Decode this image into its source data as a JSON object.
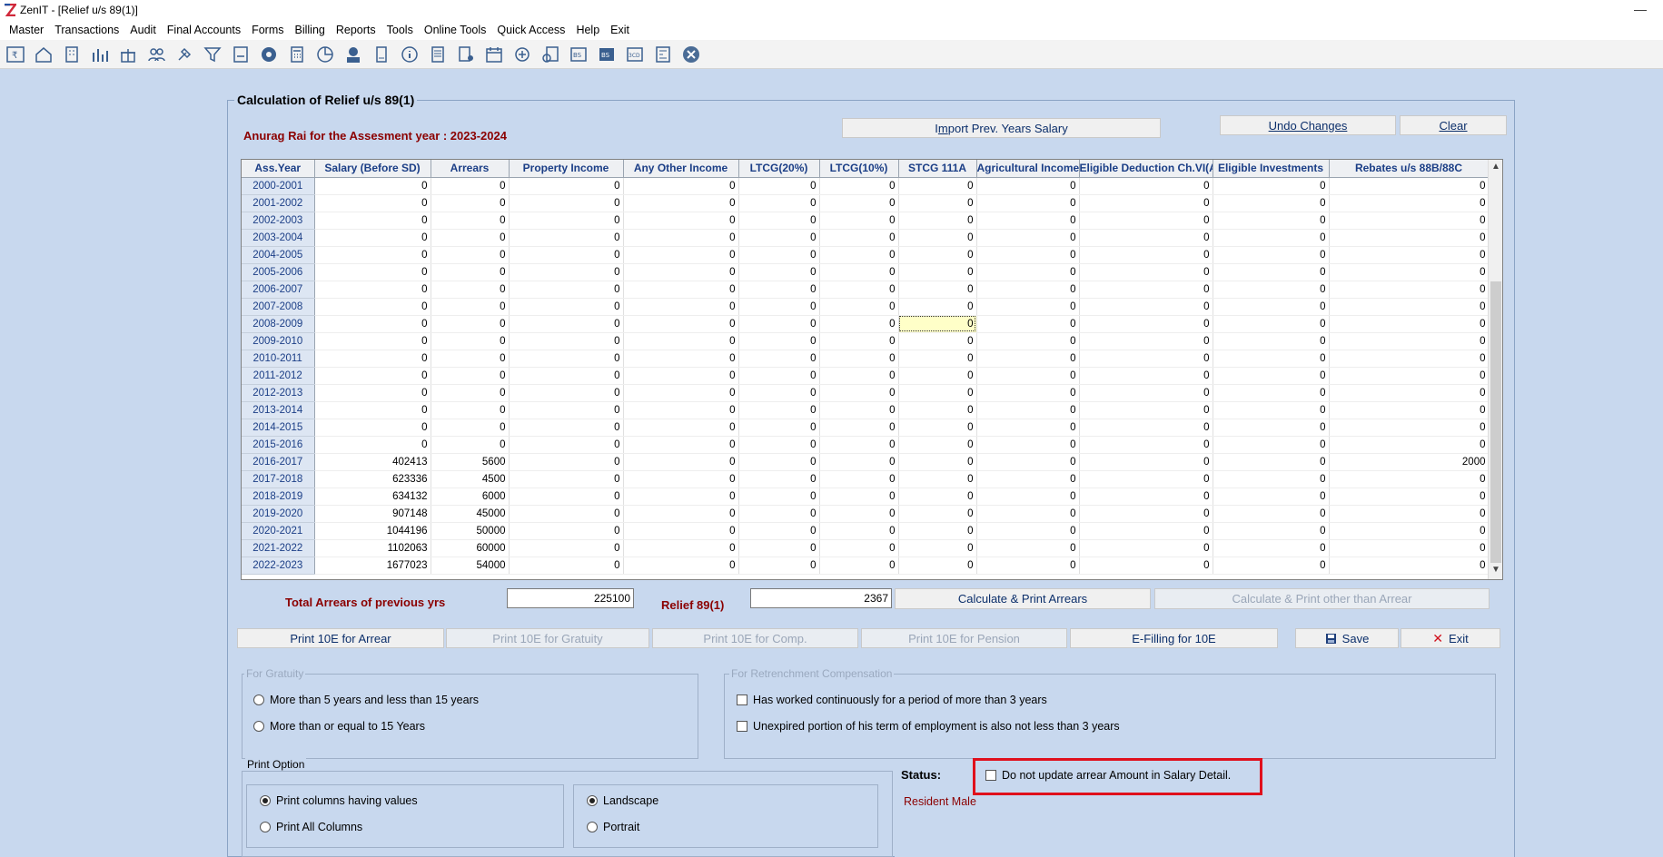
{
  "window": {
    "title": "ZenIT - [Relief u/s 89(1)]"
  },
  "menu": [
    "Master",
    "Transactions",
    "Audit",
    "Final Accounts",
    "Forms",
    "Billing",
    "Reports",
    "Tools",
    "Online Tools",
    "Quick Access",
    "Help",
    "Exit"
  ],
  "toolbar_icons": [
    "rupee-icon",
    "home-icon",
    "building-icon",
    "bar-chart-icon",
    "gift-icon",
    "users-icon",
    "hammer-icon",
    "filter-icon",
    "tax-icon",
    "disc-icon",
    "calculator-icon",
    "pie-chart-icon",
    "pay-icon",
    "book-icon",
    "info-icon",
    "report-icon",
    "person-report-icon",
    "calendar-icon",
    "add-icon",
    "search-doc-icon",
    "balance-sheet-icon",
    "bs-icon",
    "cd-icon",
    "form-icon",
    "close-icon"
  ],
  "panel": {
    "title": "Calculation of Relief u/s 89(1)",
    "assessee": "Anurag Rai for the Assesment year : 2023-2024"
  },
  "buttons": {
    "import_prefix": "I",
    "import_underline": "m",
    "import_suffix": "port Prev. Years Salary",
    "undo": "Undo Changes",
    "clear": "Clear",
    "calc_print_arrears": "Calculate & Print Arrears",
    "calc_print_other": "Calculate & Print other than Arrear",
    "print10e_arrear": "Print 10E for Arrear",
    "print10e_gratuity": "Print 10E for Gratuity",
    "print10e_comp": "Print 10E for Comp.",
    "print10e_pension": "Print 10E for Pension",
    "efiling": "E-Filling for 10E",
    "save": "Save",
    "exit": "Exit"
  },
  "grid": {
    "columns": [
      "Ass.Year",
      "Salary (Before SD)",
      "Arrears",
      "Property Income",
      "Any Other Income",
      "LTCG(20%)",
      "LTCG(10%)",
      "STCG 111A",
      "Agricultural Income",
      "Eligible Deduction Ch.VI(A)",
      "Eligible Investments",
      "Rebates u/s 88B/88C"
    ],
    "rows": [
      [
        "2000-2001",
        "0",
        "0",
        "0",
        "0",
        "0",
        "0",
        "0",
        "0",
        "0",
        "0",
        "0"
      ],
      [
        "2001-2002",
        "0",
        "0",
        "0",
        "0",
        "0",
        "0",
        "0",
        "0",
        "0",
        "0",
        "0"
      ],
      [
        "2002-2003",
        "0",
        "0",
        "0",
        "0",
        "0",
        "0",
        "0",
        "0",
        "0",
        "0",
        "0"
      ],
      [
        "2003-2004",
        "0",
        "0",
        "0",
        "0",
        "0",
        "0",
        "0",
        "0",
        "0",
        "0",
        "0"
      ],
      [
        "2004-2005",
        "0",
        "0",
        "0",
        "0",
        "0",
        "0",
        "0",
        "0",
        "0",
        "0",
        "0"
      ],
      [
        "2005-2006",
        "0",
        "0",
        "0",
        "0",
        "0",
        "0",
        "0",
        "0",
        "0",
        "0",
        "0"
      ],
      [
        "2006-2007",
        "0",
        "0",
        "0",
        "0",
        "0",
        "0",
        "0",
        "0",
        "0",
        "0",
        "0"
      ],
      [
        "2007-2008",
        "0",
        "0",
        "0",
        "0",
        "0",
        "0",
        "0",
        "0",
        "0",
        "0",
        "0"
      ],
      [
        "2008-2009",
        "0",
        "0",
        "0",
        "0",
        "0",
        "0",
        "0",
        "0",
        "0",
        "0",
        "0"
      ],
      [
        "2009-2010",
        "0",
        "0",
        "0",
        "0",
        "0",
        "0",
        "0",
        "0",
        "0",
        "0",
        "0"
      ],
      [
        "2010-2011",
        "0",
        "0",
        "0",
        "0",
        "0",
        "0",
        "0",
        "0",
        "0",
        "0",
        "0"
      ],
      [
        "2011-2012",
        "0",
        "0",
        "0",
        "0",
        "0",
        "0",
        "0",
        "0",
        "0",
        "0",
        "0"
      ],
      [
        "2012-2013",
        "0",
        "0",
        "0",
        "0",
        "0",
        "0",
        "0",
        "0",
        "0",
        "0",
        "0"
      ],
      [
        "2013-2014",
        "0",
        "0",
        "0",
        "0",
        "0",
        "0",
        "0",
        "0",
        "0",
        "0",
        "0"
      ],
      [
        "2014-2015",
        "0",
        "0",
        "0",
        "0",
        "0",
        "0",
        "0",
        "0",
        "0",
        "0",
        "0"
      ],
      [
        "2015-2016",
        "0",
        "0",
        "0",
        "0",
        "0",
        "0",
        "0",
        "0",
        "0",
        "0",
        "0"
      ],
      [
        "2016-2017",
        "402413",
        "5600",
        "0",
        "0",
        "0",
        "0",
        "0",
        "0",
        "0",
        "0",
        "2000"
      ],
      [
        "2017-2018",
        "623336",
        "4500",
        "0",
        "0",
        "0",
        "0",
        "0",
        "0",
        "0",
        "0",
        "0"
      ],
      [
        "2018-2019",
        "634132",
        "6000",
        "0",
        "0",
        "0",
        "0",
        "0",
        "0",
        "0",
        "0",
        "0"
      ],
      [
        "2019-2020",
        "907148",
        "45000",
        "0",
        "0",
        "0",
        "0",
        "0",
        "0",
        "0",
        "0",
        "0"
      ],
      [
        "2020-2021",
        "1044196",
        "50000",
        "0",
        "0",
        "0",
        "0",
        "0",
        "0",
        "0",
        "0",
        "0"
      ],
      [
        "2021-2022",
        "1102063",
        "60000",
        "0",
        "0",
        "0",
        "0",
        "0",
        "0",
        "0",
        "0",
        "0"
      ],
      [
        "2022-2023",
        "1677023",
        "54000",
        "0",
        "0",
        "0",
        "0",
        "0",
        "0",
        "0",
        "0",
        "0"
      ]
    ],
    "selected_row": 8,
    "selected_col": 7
  },
  "totals": {
    "total_arrears_label": "Total Arrears of previous yrs",
    "total_arrears_value": "225100",
    "relief_label": "Relief 89(1)",
    "relief_value": "2367"
  },
  "gratuity": {
    "title": "For Gratuity",
    "opt1": "More than 5 years and less than 15 years",
    "opt2": "More than or equal to 15 Years"
  },
  "retrenchment": {
    "title": "For Retrenchment Compensation",
    "opt1": "Has worked continuously for a period of more than 3 years",
    "opt2": "Unexpired portion of his term of employment is also not less than 3 years"
  },
  "print_option": {
    "title": "Print Option",
    "values": "Print columns having values",
    "all": "Print All Columns",
    "landscape": "Landscape",
    "portrait": "Portrait"
  },
  "status": {
    "label": "Status:",
    "value": "Resident Male",
    "no_update": "Do not update arrear Amount in Salary Detail."
  },
  "colors": {
    "accent": "#0c2f6b",
    "label_red": "#8b0000",
    "highlight": "#e0101c",
    "background": "#c8d8ee"
  }
}
